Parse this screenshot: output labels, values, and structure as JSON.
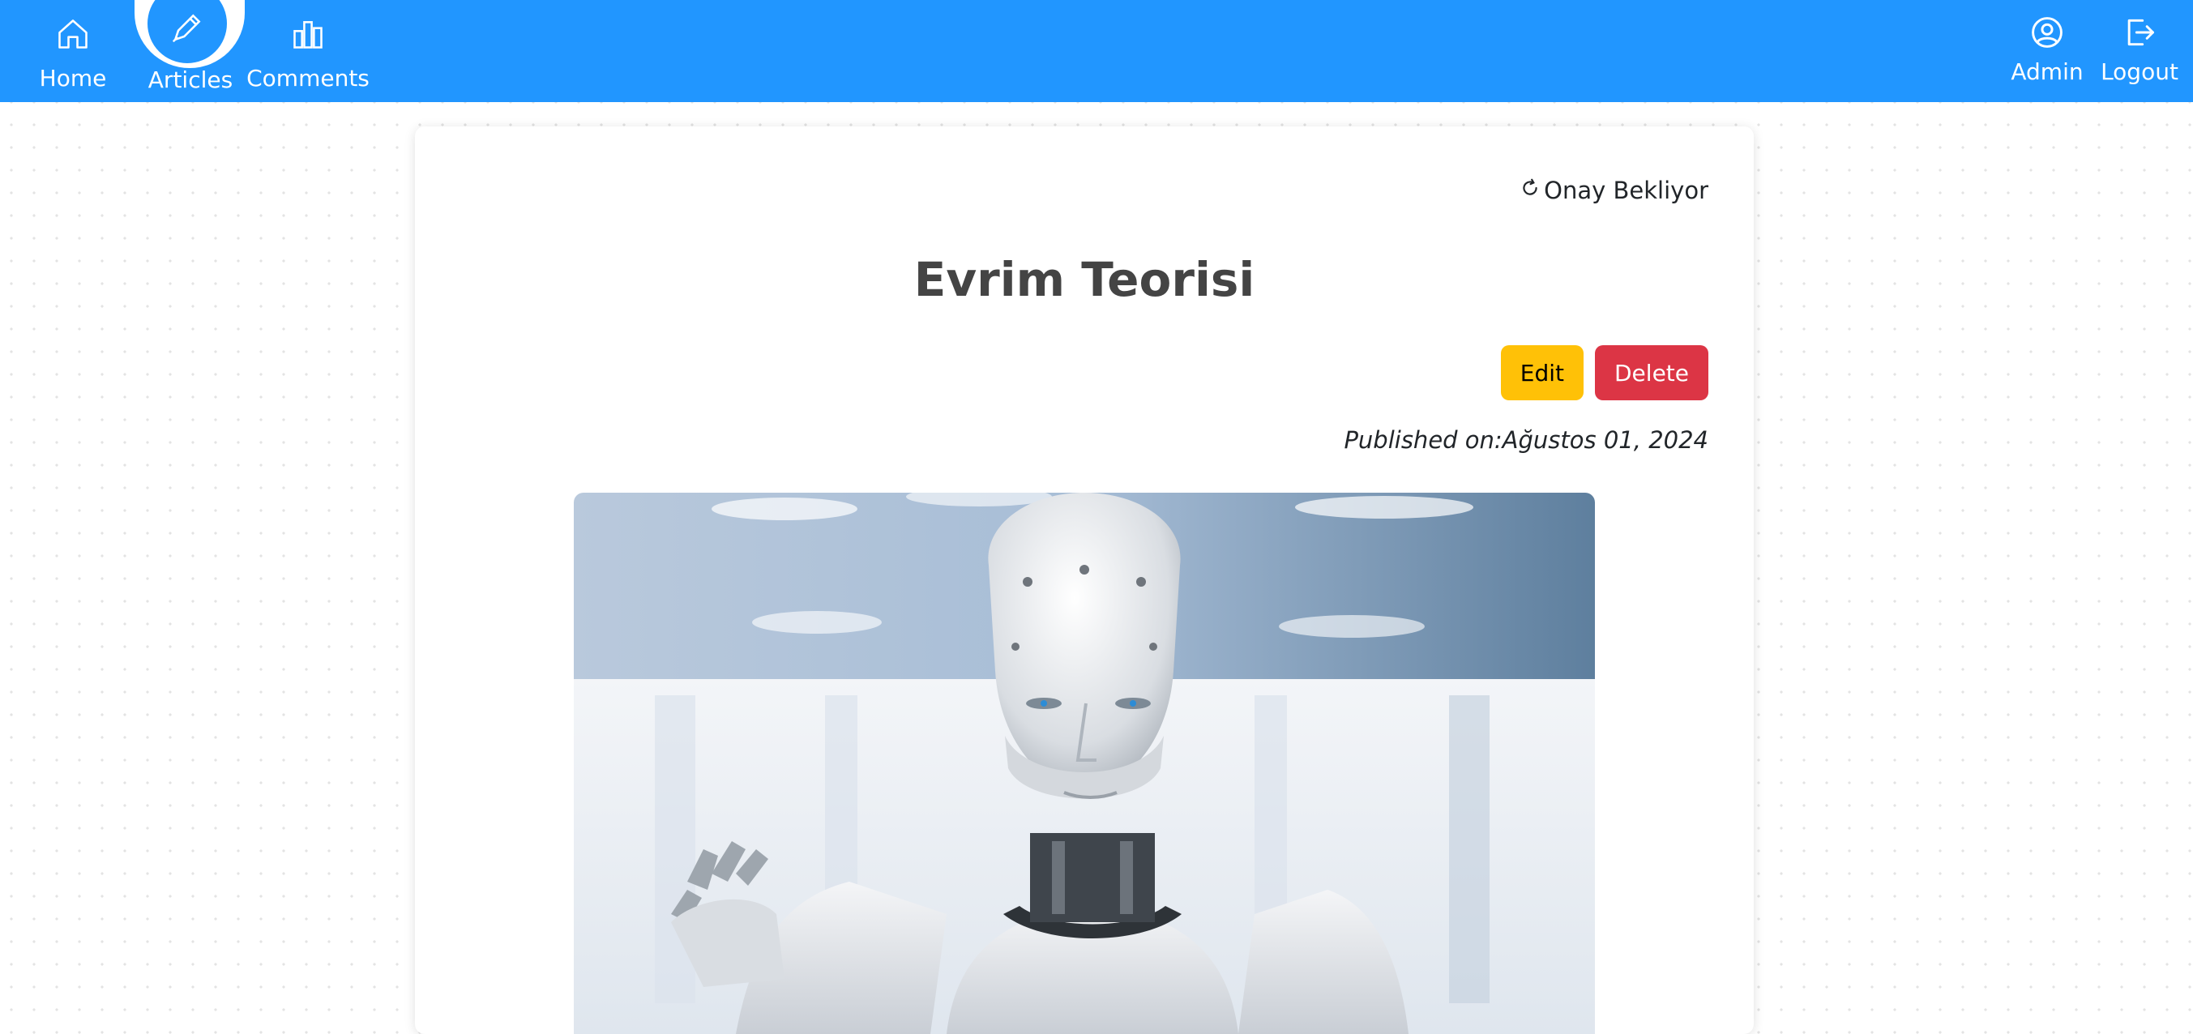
{
  "nav": {
    "home": {
      "label": "Home",
      "icon": "home-icon"
    },
    "articles": {
      "label": "Articles",
      "icon": "pen-icon"
    },
    "comments": {
      "label": "Comments",
      "icon": "bar-chart-icon"
    },
    "admin": {
      "label": "Admin",
      "icon": "user-circle-icon"
    },
    "logout": {
      "label": "Logout",
      "icon": "logout-icon"
    },
    "active": "Articles"
  },
  "article": {
    "status": "Onay Bekliyor",
    "status_icon": "refresh-icon",
    "title": "Evrim Teorisi",
    "edit_label": "Edit",
    "delete_label": "Delete",
    "published": "Published on:Ağustos 01, 2024",
    "image_icon": "humanoid-robot-image"
  },
  "colors": {
    "navbar": "#2196ff",
    "edit": "#ffc107",
    "delete": "#dc3545",
    "title": "#444444"
  }
}
